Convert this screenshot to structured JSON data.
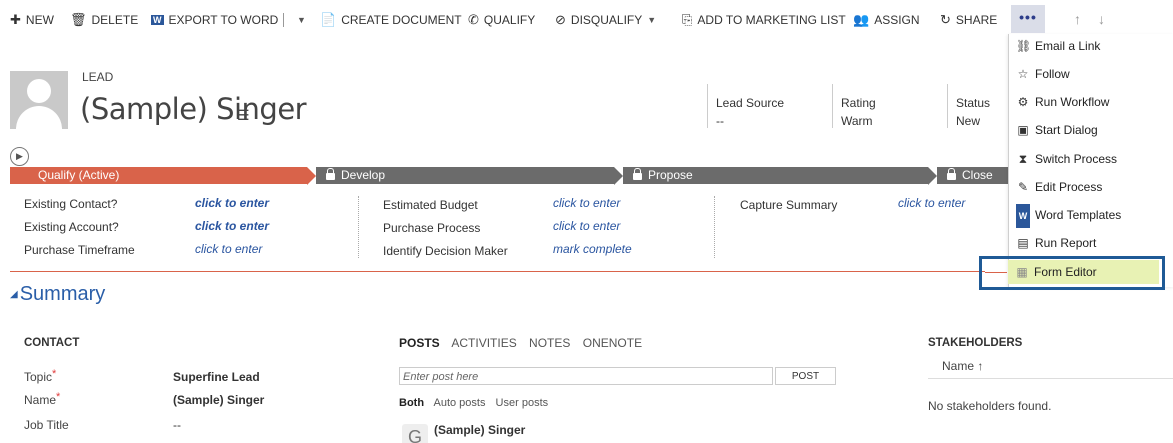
{
  "command_bar": {
    "new": "NEW",
    "delete": "DELETE",
    "export_to_word": "EXPORT TO WORD",
    "create_document": "CREATE DOCUMENT",
    "qualify": "QUALIFY",
    "disqualify": "DISQUALIFY",
    "add_to_marketing_list": "ADD TO MARKETING LIST",
    "assign": "ASSIGN",
    "share": "SHARE",
    "more": "•••"
  },
  "header": {
    "entity": "LEAD",
    "record_name": "(Sample) Singer",
    "fields": [
      {
        "label": "Lead Source",
        "value": "--"
      },
      {
        "label": "Rating",
        "value": "Warm"
      },
      {
        "label": "Status",
        "value": "New"
      }
    ]
  },
  "process": {
    "stages": [
      {
        "label": "Qualify (Active)"
      },
      {
        "label": "Develop"
      },
      {
        "label": "Propose"
      },
      {
        "label": "Close"
      }
    ],
    "col1": [
      {
        "label": "Existing Contact?",
        "value": "click to enter",
        "bold": true
      },
      {
        "label": "Existing Account?",
        "value": "click to enter",
        "bold": true
      },
      {
        "label": "Purchase Timeframe",
        "value": "click to enter",
        "bold": false
      }
    ],
    "col2": [
      {
        "label": "Estimated Budget",
        "value": "click to enter"
      },
      {
        "label": "Purchase Process",
        "value": "click to enter"
      },
      {
        "label": "Identify Decision Maker",
        "value": "mark complete"
      }
    ],
    "col3": [
      {
        "label": "Capture Summary",
        "value": "click to enter"
      }
    ]
  },
  "summary": {
    "title": "Summary",
    "contact": {
      "heading": "CONTACT",
      "rows": [
        {
          "label": "Topic",
          "required": "*",
          "value": "Superfine Lead"
        },
        {
          "label": "Name",
          "required": "*",
          "value": "(Sample) Singer"
        },
        {
          "label": "Job Title",
          "required": "",
          "value": "--"
        }
      ]
    },
    "social": {
      "tabs": [
        "POSTS",
        "ACTIVITIES",
        "NOTES",
        "ONENOTE"
      ],
      "post_placeholder": "Enter post here",
      "post_button": "POST",
      "filters": [
        "Both",
        "Auto posts",
        "User posts"
      ],
      "post_author": "(Sample) Singer"
    },
    "stakeholders": {
      "heading": "STAKEHOLDERS",
      "column": "Name ↑",
      "empty": "No stakeholders found."
    }
  },
  "overflow_menu": {
    "items": [
      {
        "label": "Email a Link",
        "icon": "link-icon"
      },
      {
        "label": "Follow",
        "icon": "star-icon"
      },
      {
        "label": "Run Workflow",
        "icon": "workflow-icon"
      },
      {
        "label": "Start Dialog",
        "icon": "dialog-icon"
      },
      {
        "label": "Switch Process",
        "icon": "switch-process-icon"
      },
      {
        "label": "Edit Process",
        "icon": "pencil-icon"
      },
      {
        "label": "Word Templates",
        "icon": "word-icon"
      },
      {
        "label": "Run Report",
        "icon": "report-icon"
      },
      {
        "label": "Form Editor",
        "icon": "form-editor-icon",
        "highlighted": true
      }
    ]
  },
  "colors": {
    "accent": "#d9634a",
    "link": "#2a55a0",
    "summary_title": "#2a5ea8",
    "highlight": "#e8f2b4",
    "frame": "#1f5a96"
  }
}
